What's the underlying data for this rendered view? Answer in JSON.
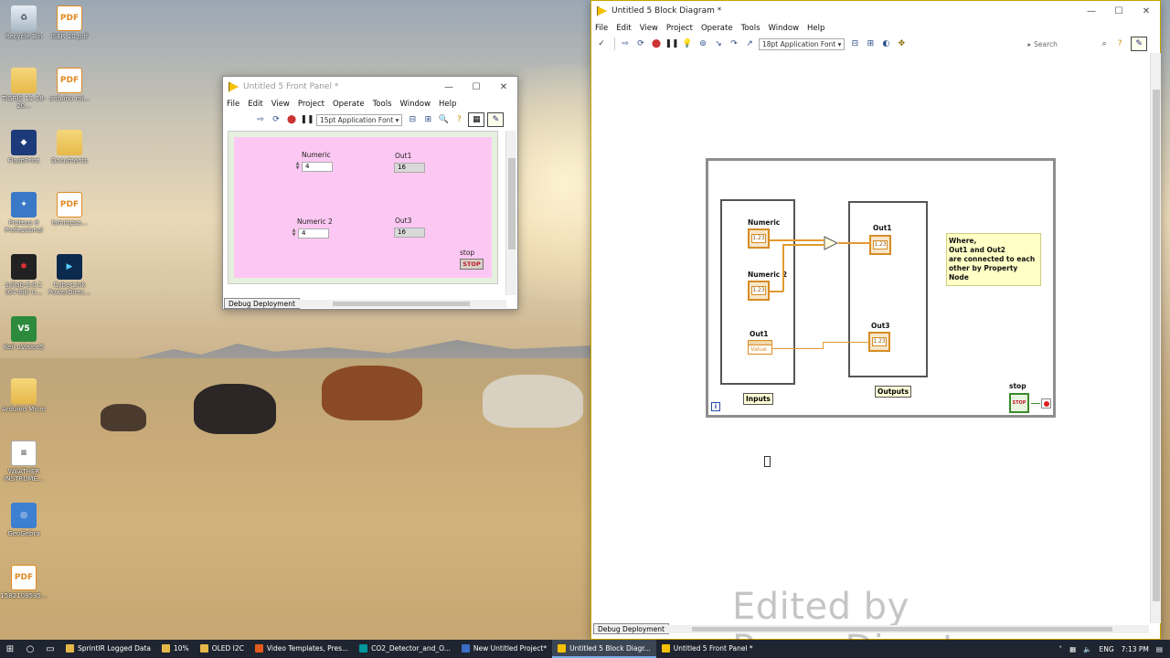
{
  "desktop": {
    "icons": [
      {
        "label": "Recycle Bin",
        "glyph": "♻",
        "kind": "g-bin"
      },
      {
        "label": "ISER 10.pdf",
        "glyph": "PDF",
        "kind": "g-pdf"
      },
      {
        "label": "TIGRIS 11-18-20...",
        "glyph": "",
        "kind": "g-folder"
      },
      {
        "label": "arduino mi...",
        "glyph": "PDF",
        "kind": "g-pdf"
      },
      {
        "label": "FlashPrint",
        "glyph": "◆",
        "kind": "g-flash"
      },
      {
        "label": "Documents",
        "glyph": "",
        "kind": "g-folder"
      },
      {
        "label": "Proteus 8 Professional",
        "glyph": "✦",
        "kind": "g-proteus"
      },
      {
        "label": "lammpsa...",
        "glyph": "PDF",
        "kind": "g-pdf"
      },
      {
        "label": "scilab-6.0.1 (64-bit) U...",
        "glyph": "✱",
        "kind": "g-scilab"
      },
      {
        "label": "CyberLink PowerDirec...",
        "glyph": "▶",
        "kind": "g-cyber"
      },
      {
        "label": "Keil uVision5",
        "glyph": "V5",
        "kind": "g-keil"
      },
      {
        "label": "Arduino Micro",
        "glyph": "",
        "kind": "g-folder"
      },
      {
        "label": "WEATHER INSTRUME...",
        "glyph": "≡",
        "kind": "g-weather"
      },
      {
        "label": "GeoGebra",
        "glyph": "◎",
        "kind": "g-geogebra"
      },
      {
        "label": "1582108595...",
        "glyph": "PDF",
        "kind": "g-pdf"
      }
    ]
  },
  "front_panel": {
    "title": "Untitled 5 Front Panel *",
    "menus": [
      "File",
      "Edit",
      "View",
      "Project",
      "Operate",
      "Tools",
      "Window",
      "Help"
    ],
    "font": "15pt Application Font",
    "controls": {
      "numeric_label": "Numeric",
      "numeric_value": "4",
      "numeric2_label": "Numeric 2",
      "numeric2_value": "4",
      "out1_label": "Out1",
      "out1_value": "16",
      "out3_label": "Out3",
      "out3_value": "16",
      "stop_label": "stop",
      "stop_button": "STOP"
    },
    "status_tab": "Debug Deployment"
  },
  "block_diagram": {
    "title": "Untitled 5 Block Diagram *",
    "menus": [
      "File",
      "Edit",
      "View",
      "Project",
      "Operate",
      "Tools",
      "Window",
      "Help"
    ],
    "font": "18pt Application Font",
    "search_placeholder": "Search",
    "nodes": {
      "numeric": "Numeric",
      "numeric2": "Numeric 2",
      "out1_prop": "Out1",
      "prop_value": "Value",
      "out1": "Out1",
      "out3": "Out3",
      "inputs_label": "Inputs",
      "outputs_label": "Outputs",
      "stop_label": "stop",
      "stop_term": "STOP",
      "iteration": "i",
      "terminal_text": "1.23"
    },
    "comment_lines": [
      "Where,",
      "Out1 and Out2",
      "are connected to each",
      "other by Property Node"
    ],
    "status_tab": "Debug Deployment",
    "watermark": "Edited by PowerDirector"
  },
  "taskbar": {
    "items": [
      {
        "label": "SprintIR Logged Data",
        "color": "#e6b84a",
        "active": false
      },
      {
        "label": "10%",
        "color": "#e6b84a",
        "active": false
      },
      {
        "label": "OLED I2C",
        "color": "#e6b84a",
        "active": false
      },
      {
        "label": "Video Templates, Pres...",
        "color": "#e25a1c",
        "active": false
      },
      {
        "label": "CO2_Detector_and_O...",
        "color": "#00979c",
        "active": false
      },
      {
        "label": "New Untitled Project*",
        "color": "#3a6ec7",
        "active": false
      },
      {
        "label": "Untitled 5 Block Diagr...",
        "color": "#f5c000",
        "active": true
      },
      {
        "label": "Untitled 5 Front Panel *",
        "color": "#f5c000",
        "active": false
      }
    ],
    "language": "ENG",
    "time": "7:13 PM"
  }
}
